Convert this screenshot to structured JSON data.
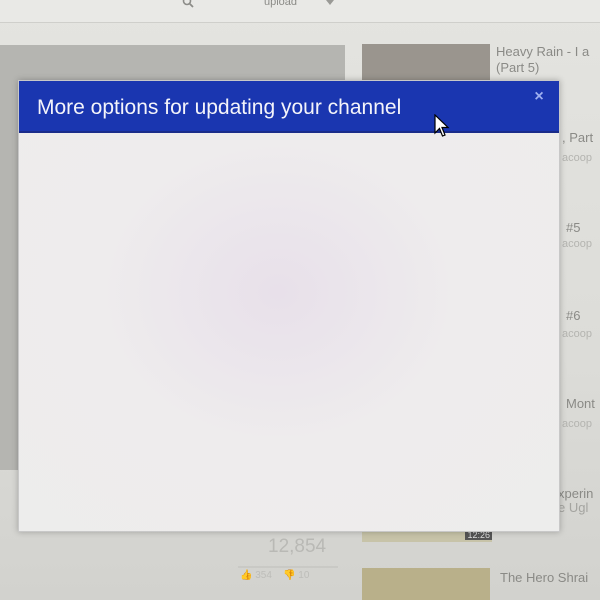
{
  "topbar": {
    "search_icon": "search-icon",
    "upload_label": "upload"
  },
  "video": {
    "view_count": "12,854",
    "likes": "354",
    "dislikes": "10"
  },
  "sidebar": {
    "items": [
      {
        "title": "Heavy Rain - I a",
        "subtitle": "(Part 5)"
      },
      {
        "title": ", Part",
        "subtitle": "acoop"
      },
      {
        "title": "#5",
        "subtitle": "acoop"
      },
      {
        "title": "#6",
        "subtitle": "acoop"
      },
      {
        "title": "Mont",
        "subtitle": "acoop"
      },
      {
        "title": "xperin",
        "subtitle": "e Ugl"
      },
      {
        "title": "The Hero Shrai",
        "subtitle": ""
      }
    ],
    "duration": "12:26"
  },
  "modal": {
    "title": "More options for updating your channel",
    "close_label": "×"
  },
  "colors": {
    "header_blue": "#1a36b0",
    "modal_body": "#efeeef"
  }
}
